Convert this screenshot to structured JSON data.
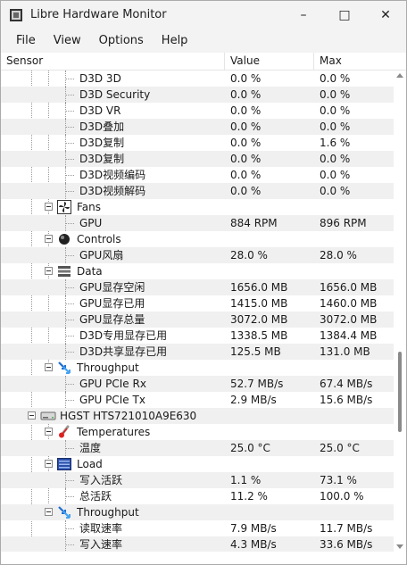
{
  "window": {
    "title": "Libre Hardware Monitor"
  },
  "menu": [
    "File",
    "View",
    "Options",
    "Help"
  ],
  "columns": {
    "sensor": "Sensor",
    "value": "Value",
    "max": "Max"
  },
  "rows": [
    {
      "level": 3,
      "name": "D3D 3D",
      "value": "0.0 %",
      "max": "0.0 %"
    },
    {
      "level": 3,
      "name": "D3D Security",
      "value": "0.0 %",
      "max": "0.0 %"
    },
    {
      "level": 3,
      "name": "D3D VR",
      "value": "0.0 %",
      "max": "0.0 %"
    },
    {
      "level": 3,
      "name": "D3D叠加",
      "value": "0.0 %",
      "max": "0.0 %"
    },
    {
      "level": 3,
      "name": "D3D复制",
      "value": "0.0 %",
      "max": "1.6 %"
    },
    {
      "level": 3,
      "name": "D3D复制",
      "value": "0.0 %",
      "max": "0.0 %"
    },
    {
      "level": 3,
      "name": "D3D视频编码",
      "value": "0.0 %",
      "max": "0.0 %"
    },
    {
      "level": 3,
      "name": "D3D视频解码",
      "value": "0.0 %",
      "max": "0.0 %"
    },
    {
      "level": 2,
      "name": "Fans",
      "icon": "fan-icon",
      "value": "",
      "max": ""
    },
    {
      "level": 3,
      "name": "GPU",
      "value": "884 RPM",
      "max": "896 RPM"
    },
    {
      "level": 2,
      "name": "Controls",
      "icon": "control-knob-icon",
      "value": "",
      "max": ""
    },
    {
      "level": 3,
      "name": "GPU风扇",
      "value": "28.0 %",
      "max": "28.0 %"
    },
    {
      "level": 2,
      "name": "Data",
      "icon": "data-stack-icon",
      "value": "",
      "max": ""
    },
    {
      "level": 3,
      "name": "GPU显存空闲",
      "value": "1656.0 MB",
      "max": "1656.0 MB"
    },
    {
      "level": 3,
      "name": "GPU显存已用",
      "value": "1415.0 MB",
      "max": "1460.0 MB"
    },
    {
      "level": 3,
      "name": "GPU显存总量",
      "value": "3072.0 MB",
      "max": "3072.0 MB"
    },
    {
      "level": 3,
      "name": "D3D专用显存已用",
      "value": "1338.5 MB",
      "max": "1384.4 MB"
    },
    {
      "level": 3,
      "name": "D3D共享显存已用",
      "value": "125.5 MB",
      "max": "131.0 MB"
    },
    {
      "level": 2,
      "name": "Throughput",
      "icon": "throughput-arrows-icon",
      "value": "",
      "max": ""
    },
    {
      "level": 3,
      "name": "GPU PCIe Rx",
      "value": "52.7 MB/s",
      "max": "67.4 MB/s"
    },
    {
      "level": 3,
      "name": "GPU PCIe Tx",
      "value": "2.9 MB/s",
      "max": "15.6 MB/s"
    },
    {
      "level": 1,
      "name": "HGST HTS721010A9E630",
      "icon": "hard-drive-icon",
      "value": "",
      "max": ""
    },
    {
      "level": 2,
      "name": "Temperatures",
      "icon": "thermometer-icon",
      "value": "",
      "max": ""
    },
    {
      "level": 3,
      "name": "温度",
      "value": "25.0 °C",
      "max": "25.0 °C"
    },
    {
      "level": 2,
      "name": "Load",
      "icon": "load-bars-icon",
      "value": "",
      "max": ""
    },
    {
      "level": 3,
      "name": "写入活跃",
      "value": "1.1 %",
      "max": "73.1 %"
    },
    {
      "level": 3,
      "name": "总活跃",
      "value": "11.2 %",
      "max": "100.0 %"
    },
    {
      "level": 2,
      "name": "Throughput",
      "icon": "throughput-arrows-icon",
      "value": "",
      "max": ""
    },
    {
      "level": 3,
      "name": "读取速率",
      "value": "7.9 MB/s",
      "max": "11.7 MB/s"
    },
    {
      "level": 3,
      "name": "写入速率",
      "value": "4.3 MB/s",
      "max": "33.6 MB/s"
    }
  ]
}
